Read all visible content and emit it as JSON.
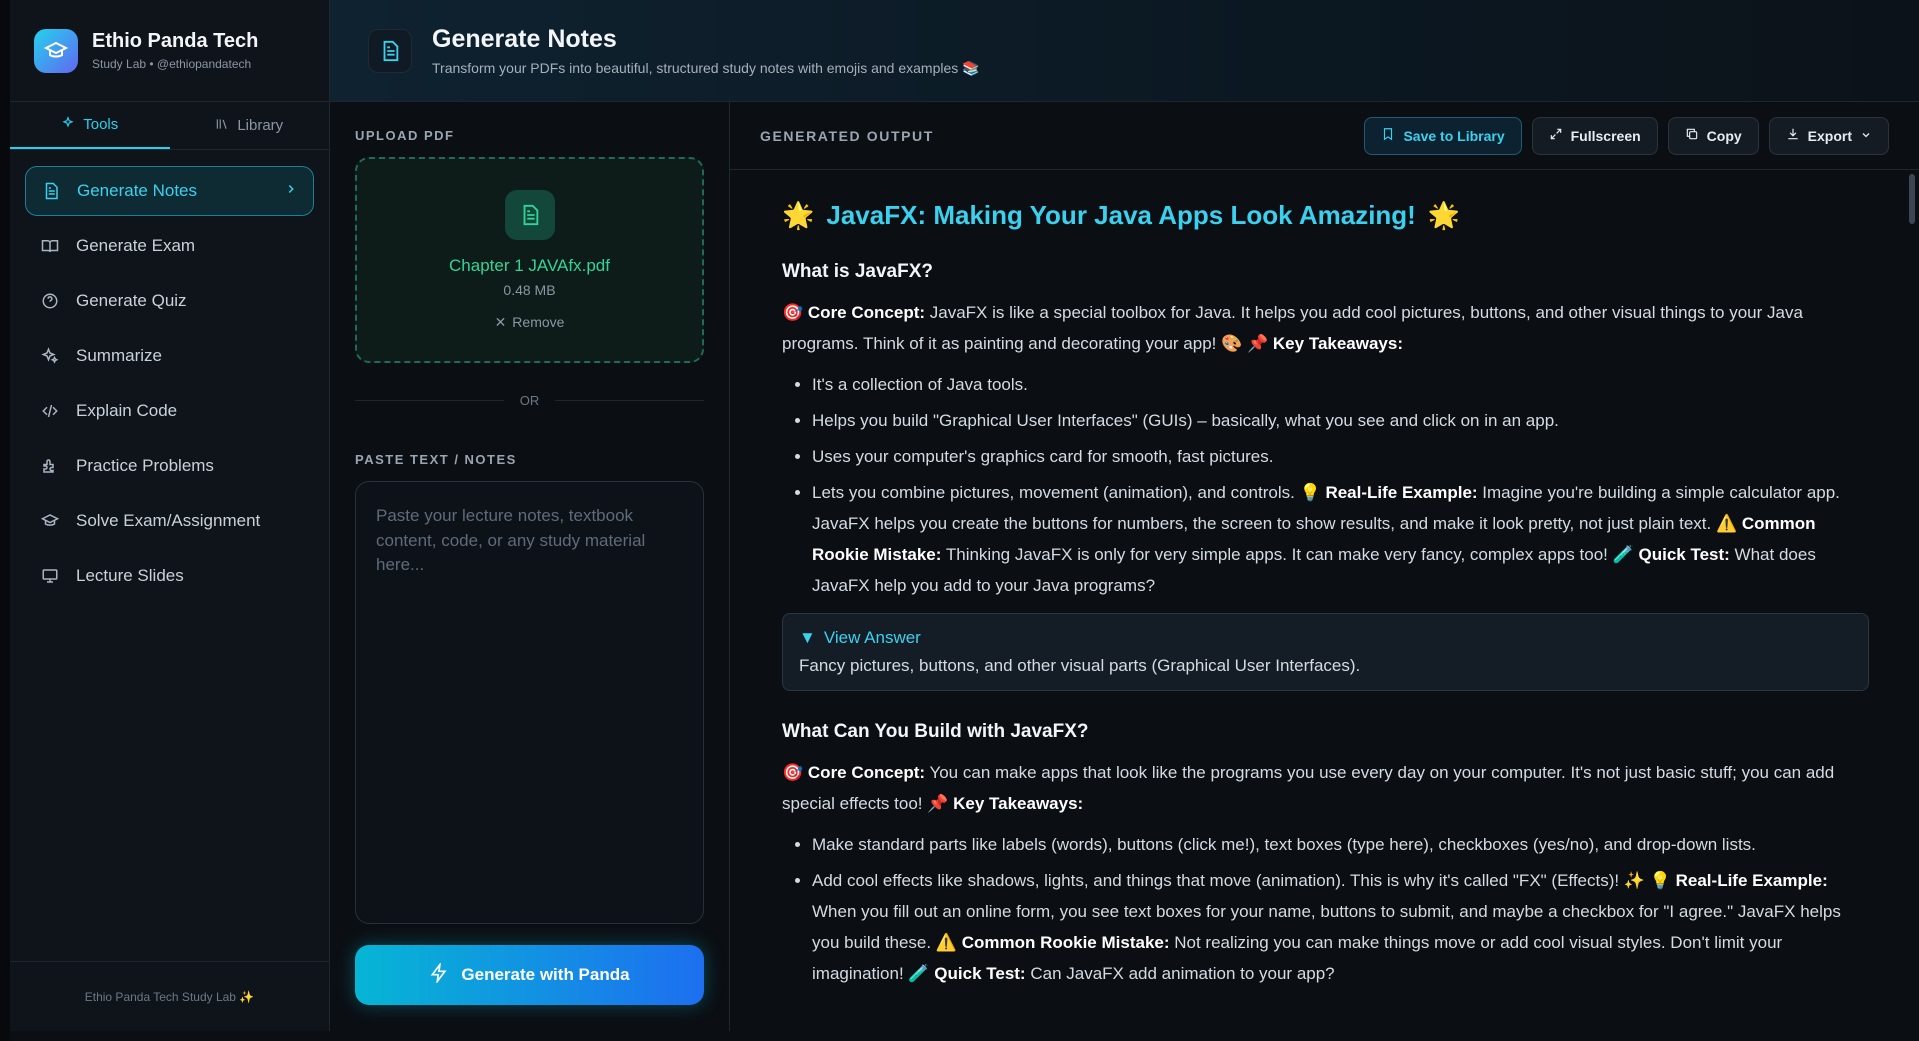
{
  "brand": {
    "title": "Ethio Panda Tech",
    "subtitle": "Study Lab • @ethiopandatech"
  },
  "tabs": [
    {
      "label": "Tools"
    },
    {
      "label": "Library"
    }
  ],
  "nav": [
    {
      "label": "Generate Notes"
    },
    {
      "label": "Generate Exam"
    },
    {
      "label": "Generate Quiz"
    },
    {
      "label": "Summarize"
    },
    {
      "label": "Explain Code"
    },
    {
      "label": "Practice Problems"
    },
    {
      "label": "Solve Exam/Assignment"
    },
    {
      "label": "Lecture Slides"
    }
  ],
  "sidebar_footer": "Ethio Panda Tech Study Lab ✨",
  "header": {
    "title": "Generate Notes",
    "subtitle": "Transform your PDFs into beautiful, structured study notes with emojis and examples 📚"
  },
  "upload": {
    "label": "UPLOAD PDF",
    "file_name": "Chapter 1 JAVAfx.pdf",
    "file_size": "0.48 MB",
    "remove_label": "Remove"
  },
  "divider": "OR",
  "paste": {
    "label": "PASTE TEXT / NOTES",
    "placeholder": "Paste your lecture notes, textbook content, code, or any study material here..."
  },
  "generate_button": "Generate with Panda",
  "output": {
    "label": "GENERATED OUTPUT",
    "actions": {
      "save": "Save to Library",
      "fullscreen": "Fullscreen",
      "copy": "Copy",
      "export": "Export"
    },
    "title": "JavaFX: Making Your Java Apps Look Amazing!",
    "title_emoji": "🌟",
    "s1_heading": "What is JavaFX?",
    "s1_core_label": "Core Concept:",
    "s1_core_text": " JavaFX is like a special toolbox for Java. It helps you add cool pictures, buttons, and other visual things to your Java programs. Think of it as painting and decorating your app! 🎨 📌 ",
    "s1_takeaways_label": "Key Takeaways:",
    "s1_items": [
      "It's a collection of Java tools.",
      "Helps you build \"Graphical User Interfaces\" (GUIs) – basically, what you see and click on in an app.",
      "Uses your computer's graphics card for smooth, fast pictures."
    ],
    "s1_item4_a": "Lets you combine pictures, movement (animation), and controls. 💡 ",
    "s1_item4_rl_label": "Real-Life Example:",
    "s1_item4_b": " Imagine you're building a simple calculator app. JavaFX helps you create the buttons for numbers, the screen to show results, and make it look pretty, not just plain text. ⚠️ ",
    "s1_item4_mistake_label": "Common Rookie Mistake:",
    "s1_item4_c": " Thinking JavaFX is only for very simple apps. It can make very fancy, complex apps too! 🧪 ",
    "s1_item4_qt_label": "Quick Test:",
    "s1_item4_d": " What does JavaFX help you add to your Java programs?",
    "answer_title": "View Answer",
    "answer_body": "Fancy pictures, buttons, and other visual parts (Graphical User Interfaces).",
    "s2_heading": "What Can You Build with JavaFX?",
    "s2_core_label": "Core Concept:",
    "s2_core_text": " You can make apps that look like the programs you use every day on your computer. It's not just basic stuff; you can add special effects too! 📌 ",
    "s2_takeaways_label": "Key Takeaways:",
    "s2_item1": "Make standard parts like labels (words), buttons (click me!), text boxes (type here), checkboxes (yes/no), and drop-down lists.",
    "s2_item2_a": "Add cool effects like shadows, lights, and things that move (animation). This is why it's called \"FX\" (Effects)! ✨ 💡 ",
    "s2_item2_rl_label": "Real-Life Example:",
    "s2_item2_b": " When you fill out an online form, you see text boxes for your name, buttons to submit, and maybe a checkbox for \"I agree.\" JavaFX helps you build these. ⚠️ ",
    "s2_item2_mistake_label": "Common Rookie Mistake:",
    "s2_item2_c": " Not realizing you can make things move or add cool visual styles. Don't limit your imagination! 🧪 ",
    "s2_item2_qt_label": "Quick Test:",
    "s2_item2_d": " Can JavaFX add animation to your app?"
  }
}
